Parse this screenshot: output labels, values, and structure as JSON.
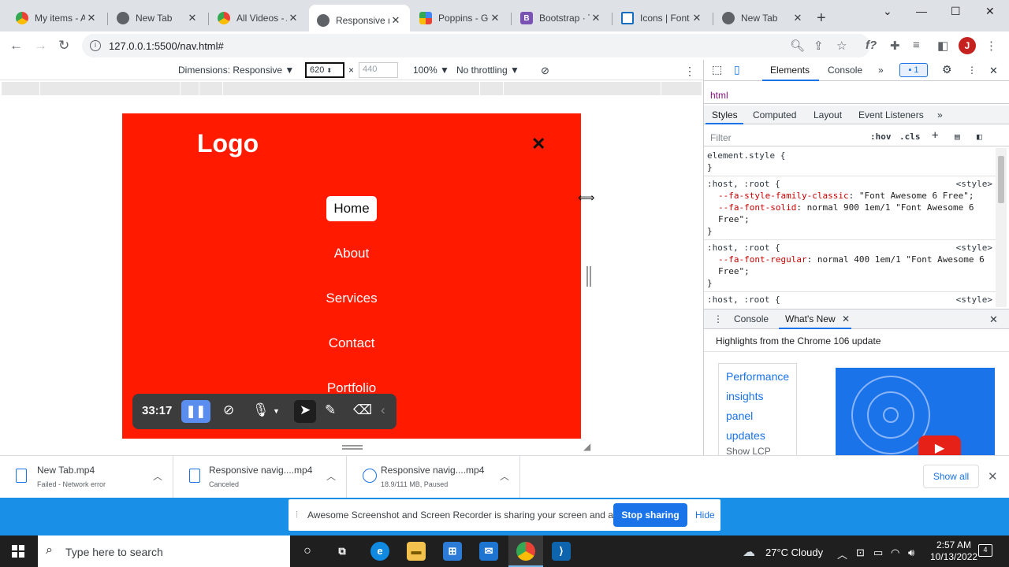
{
  "tabs": [
    {
      "title": "My items - A",
      "favicon": "chrome-icon"
    },
    {
      "title": "New Tab",
      "favicon": "chrome-icon"
    },
    {
      "title": "All Videos - A",
      "favicon": "chrome-icon"
    },
    {
      "title": "Responsive n",
      "favicon": "globe-icon",
      "active": true
    },
    {
      "title": "Poppins - Go",
      "favicon": "google-fonts-icon"
    },
    {
      "title": "Bootstrap · Th",
      "favicon": "bootstrap-icon"
    },
    {
      "title": "Icons | Font A",
      "favicon": "font-awesome-icon"
    },
    {
      "title": "New Tab",
      "favicon": "chrome-icon"
    }
  ],
  "address": {
    "url": "127.0.0.1:5500/nav.html#"
  },
  "profile": {
    "initial": "J"
  },
  "device_toolbar": {
    "dimensions_label": "Dimensions: Responsive",
    "width": "620",
    "height_placeholder": "440",
    "zoom": "100%",
    "throttling": "No throttling",
    "times": "×"
  },
  "page": {
    "logo": "Logo",
    "close_glyph": "✕",
    "nav": [
      "Home",
      "About",
      "Services",
      "Contact",
      "Portfolio"
    ],
    "background": "#ff1a00"
  },
  "recorder": {
    "time": "33:17"
  },
  "devtools": {
    "tabs": [
      "Elements",
      "Console"
    ],
    "issues_badge": "1",
    "breadcrumb": "html",
    "style_tabs": [
      "Styles",
      "Computed",
      "Layout",
      "Event Listeners"
    ],
    "filter_placeholder": "Filter",
    "hov": ":hov",
    "cls": ".cls",
    "rules": [
      {
        "selector": "element.style {",
        "source": "",
        "props": [],
        "end": "}"
      },
      {
        "selector": ":host, :root {",
        "source": "<style>",
        "props": [
          {
            "name": "--fa-style-family-classic",
            "value": "\"Font Awesome 6 Free\";"
          },
          {
            "name": "--fa-font-solid",
            "value": "normal 900 1em/1 \"Font Awesome 6 Free\";"
          }
        ],
        "end": "}"
      },
      {
        "selector": ":host, :root {",
        "source": "<style>",
        "props": [
          {
            "name": "--fa-font-regular",
            "value": "normal 400 1em/1 \"Font Awesome 6 Free\";"
          }
        ],
        "end": "}"
      },
      {
        "selector": ":host, :root {",
        "source": "<style>",
        "props": [],
        "end": ""
      }
    ],
    "drawer_tabs": [
      "Console",
      "What's New"
    ],
    "whats_new_heading": "Highlights from the Chrome 106 update",
    "whats_new_links": [
      "Performance",
      "insights",
      "panel",
      "updates"
    ],
    "whats_new_sub": "Show LCP"
  },
  "downloads": [
    {
      "name": "New Tab.mp4",
      "status": "Failed - Network error"
    },
    {
      "name": "Responsive navig....mp4",
      "status": "Canceled"
    },
    {
      "name": "Responsive navig....mp4",
      "status": "18.9/111 MB, Paused"
    }
  ],
  "download_bar": {
    "show_all": "Show all"
  },
  "share_banner": {
    "message": "Awesome Screenshot and Screen Recorder is sharing your screen and audio.",
    "stop": "Stop sharing",
    "hide": "Hide"
  },
  "taskbar": {
    "search_placeholder": "Type here to search",
    "weather": "27°C  Cloudy",
    "time": "2:57 AM",
    "date": "10/13/2022",
    "notifications": "4"
  }
}
